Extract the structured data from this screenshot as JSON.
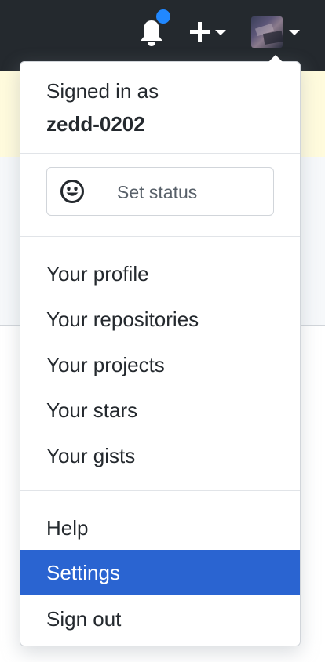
{
  "header": {
    "notifications_icon": "bell-icon",
    "new_icon": "plus-icon",
    "avatar_icon": "avatar"
  },
  "dropdown": {
    "signed_in_label": "Signed in as",
    "username": "zedd-0202",
    "set_status_label": "Set status",
    "status_icon": "smiley-icon",
    "profile_items": [
      {
        "label": "Your profile"
      },
      {
        "label": "Your repositories"
      },
      {
        "label": "Your projects"
      },
      {
        "label": "Your stars"
      },
      {
        "label": "Your gists"
      }
    ],
    "account_items": [
      {
        "label": "Help"
      },
      {
        "label": "Settings",
        "active": true
      },
      {
        "label": "Sign out"
      }
    ]
  },
  "colors": {
    "header_bg": "#24292e",
    "notification_dot": "#2188ff",
    "active_item_bg": "#2a64d1",
    "banner_bg": "#fffbdd"
  }
}
